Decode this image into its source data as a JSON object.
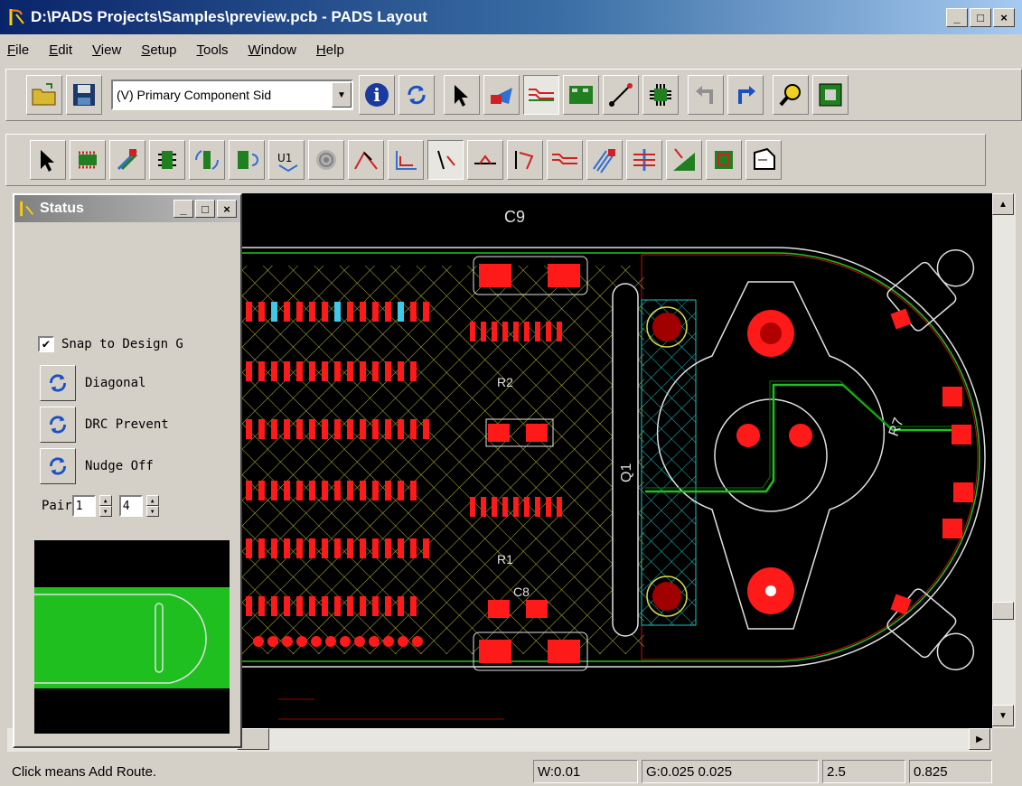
{
  "window": {
    "title": "D:\\PADS Projects\\Samples\\preview.pcb - PADS Layout",
    "minimize": "_",
    "maximize": "□",
    "close": "×"
  },
  "menu": [
    "File",
    "Edit",
    "View",
    "Setup",
    "Tools",
    "Window",
    "Help"
  ],
  "toolbar": {
    "layer_select": "(V) Primary Component Sid"
  },
  "status_panel": {
    "title": "Status",
    "snap_label": "Snap to Design G",
    "snap_checked": true,
    "diagonal_label": "Diagonal",
    "drc_label": "DRC Prevent",
    "nudge_label": "Nudge Off",
    "pair_label": "Pair",
    "pair_value1": "1",
    "pair_value2": "4"
  },
  "canvas": {
    "labels": {
      "c9": "C9",
      "q1": "Q1",
      "r7": "R7",
      "r2": "R2",
      "r1": "R1",
      "c8": "C8"
    }
  },
  "statusbar": {
    "message": "Click means Add Route.",
    "width": "W:0.01",
    "grid": "G:0.025 0.025",
    "x": "2.5",
    "y": "0.825"
  },
  "colors": {
    "board_bg": "#000000",
    "pad_red": "#ff1a1a",
    "trace_green": "#1fbf1f",
    "hatch_yellow": "#d8d840",
    "hatch_cyan": "#20c0c0",
    "outline_white": "#e0e0e0"
  }
}
